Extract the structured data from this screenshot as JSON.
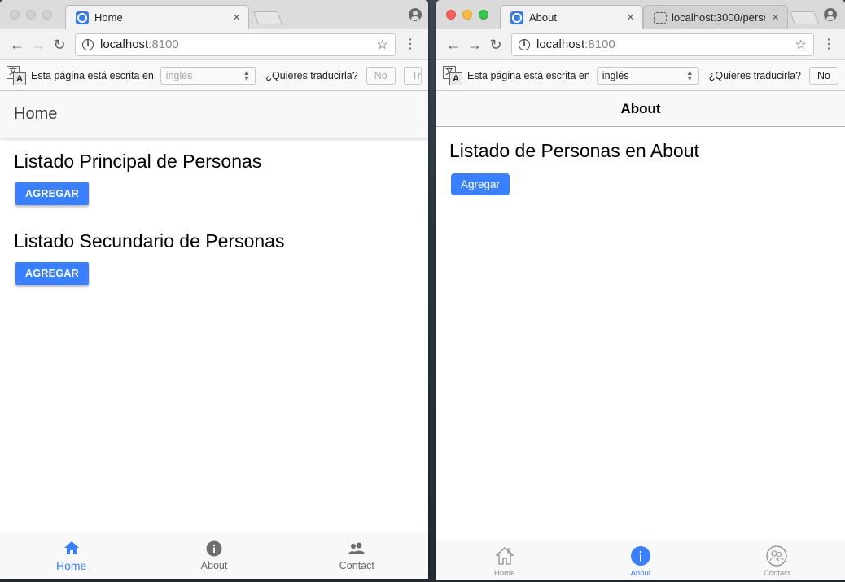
{
  "left_window": {
    "tab": {
      "title": "Home",
      "close": "×"
    },
    "address": {
      "host": "localhost",
      "port": ":8100"
    },
    "translate": {
      "prefix": "Esta página está escrita en",
      "language": "inglés",
      "question": "¿Quieres traducirla?",
      "no_label": "No",
      "translate_partial": "Tr"
    },
    "app": {
      "header_title": "Home",
      "section1_title": "Listado Principal de Personas",
      "section1_button": "AGREGAR",
      "section2_title": "Listado Secundario de Personas",
      "section2_button": "AGREGAR",
      "tabs": [
        {
          "label": "Home",
          "icon": "home-icon",
          "selected": true
        },
        {
          "label": "About",
          "icon": "info-icon",
          "selected": false
        },
        {
          "label": "Contact",
          "icon": "contacts-icon",
          "selected": false
        }
      ]
    }
  },
  "right_window": {
    "tabs": [
      {
        "title": "About",
        "close": "×"
      },
      {
        "title": "localhost:3000/perso",
        "close": "×"
      }
    ],
    "address": {
      "host": "localhost",
      "port": ":8100"
    },
    "translate": {
      "prefix": "Esta página está escrita en",
      "language": "inglés",
      "question": "¿Quieres traducirla?",
      "no_label": "No"
    },
    "app": {
      "header_title": "About",
      "section_title": "Listado de Personas en About",
      "button": "Agregar",
      "tabs": [
        {
          "label": "Home",
          "icon": "home-outline-icon",
          "selected": false
        },
        {
          "label": "About",
          "icon": "info-icon",
          "selected": true
        },
        {
          "label": "Contact",
          "icon": "contacts-outline-icon",
          "selected": false
        }
      ]
    }
  },
  "colors": {
    "primary": "#3880ff",
    "toolbar_bg": "#f8f8f8"
  }
}
